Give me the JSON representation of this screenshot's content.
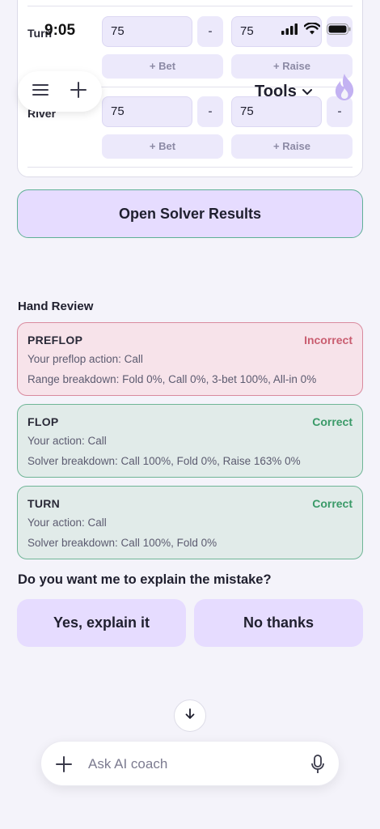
{
  "status": {
    "time": "9:05"
  },
  "streets": [
    {
      "label": "Turn",
      "hero_value": "75",
      "villain_value": "75",
      "minus_label": "-",
      "bet_label": "+ Bet",
      "raise_label": "+ Raise"
    },
    {
      "label": "River",
      "hero_value": "75",
      "villain_value": "75",
      "minus_label": "-",
      "bet_label": "+ Bet",
      "raise_label": "+ Raise"
    }
  ],
  "header": {
    "tools_label": "Tools"
  },
  "open_solver_label": "Open Solver Results",
  "hand_review": {
    "title": "Hand Review",
    "cards": [
      {
        "street": "PREFLOP",
        "verdict": "Incorrect",
        "line1": "Your preflop action: Call",
        "line2": "Range breakdown: Fold 0%, Call 0%, 3-bet 100%, All-in 0%"
      },
      {
        "street": "FLOP",
        "verdict": "Correct",
        "line1": "Your action: Call",
        "line2": "Solver breakdown: Call 100%, Fold 0%, Raise 163% 0%"
      },
      {
        "street": "TURN",
        "verdict": "Correct",
        "line1": "Your action: Call",
        "line2": "Solver breakdown: Call 100%, Fold 0%"
      }
    ]
  },
  "question": "Do you want me to explain the mistake?",
  "choices": {
    "yes_label": "Yes, explain it",
    "no_label": "No thanks"
  },
  "composer": {
    "placeholder": "Ask AI coach"
  },
  "colors": {
    "accent": "#e6dcff",
    "correct": "#3a9a68",
    "incorrect": "#c95d70"
  }
}
